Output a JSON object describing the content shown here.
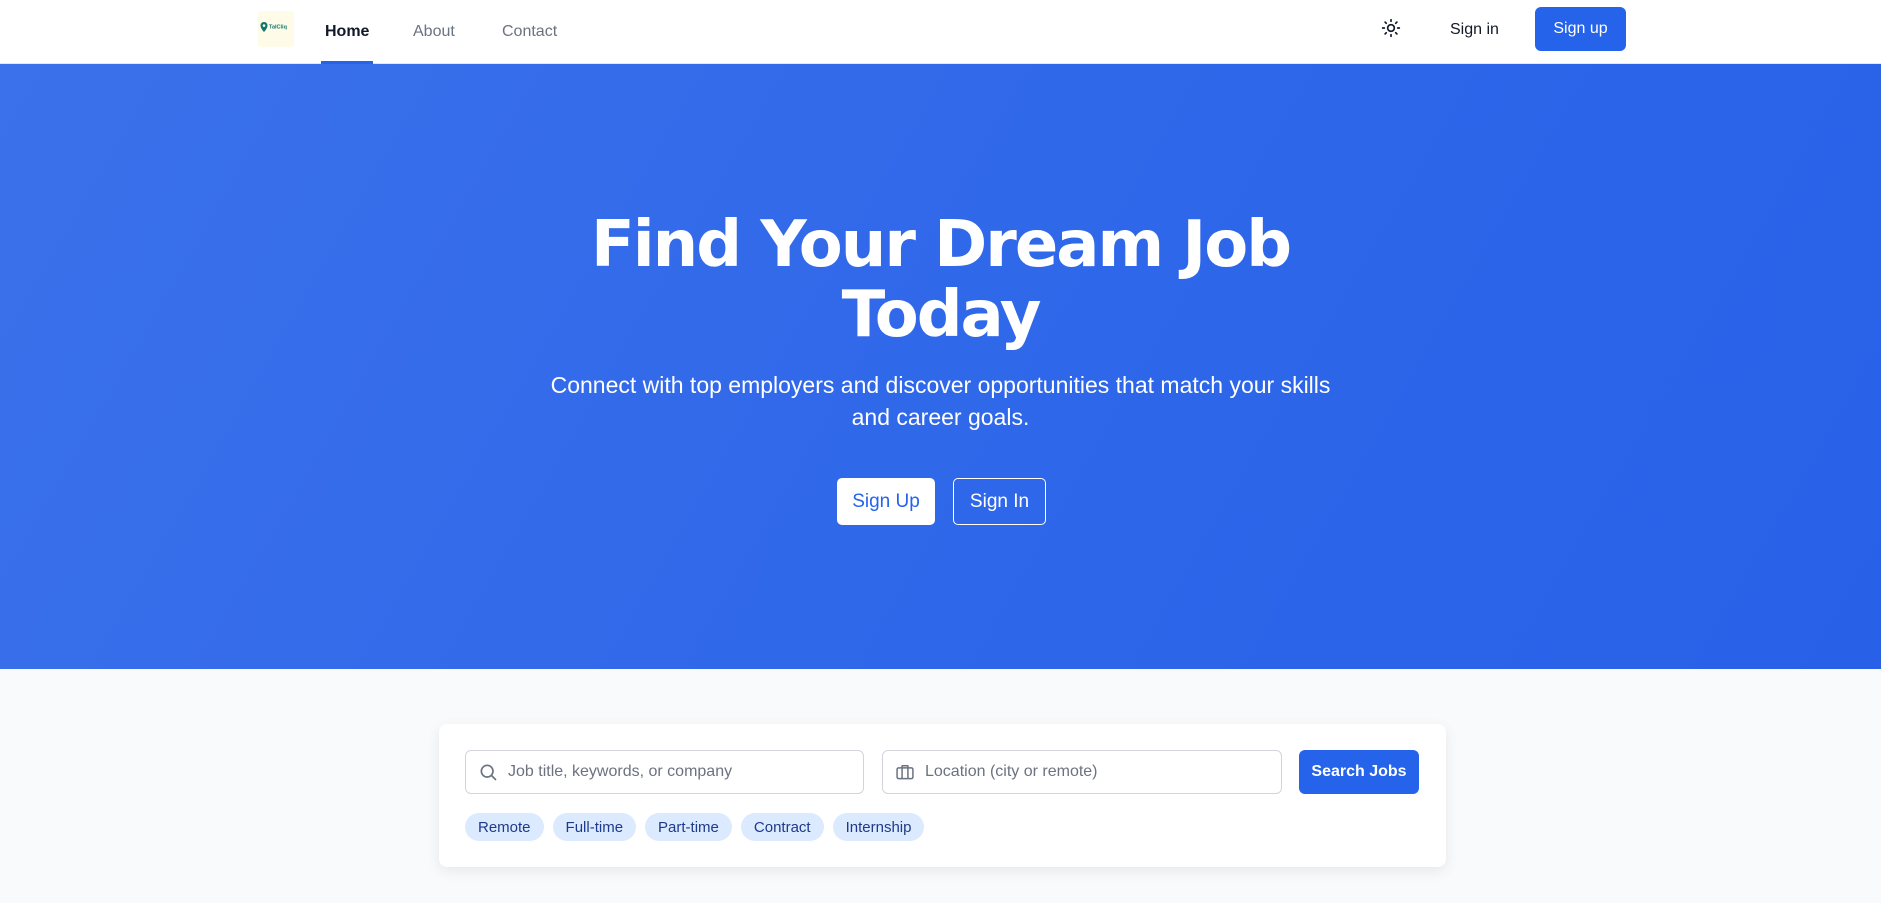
{
  "nav": {
    "logo_text": "TalCliq",
    "links": [
      "Home",
      "About",
      "Contact"
    ],
    "signin": "Sign in",
    "signup": "Sign up"
  },
  "hero": {
    "title_line1": "Find Your Dream Job",
    "title_line2": "Today",
    "subtitle": "Connect with top employers and discover opportunities that match your skills and career goals.",
    "signup": "Sign Up",
    "signin": "Sign In"
  },
  "search": {
    "job_placeholder": "Job title, keywords, or company",
    "location_placeholder": "Location (city or remote)",
    "button": "Search Jobs",
    "chips": [
      "Remote",
      "Full-time",
      "Part-time",
      "Contract",
      "Internship"
    ]
  },
  "colors": {
    "primary": "#2563eb",
    "hero_bg": "#3068ea",
    "chip_bg": "#dbeafe",
    "chip_text": "#1e3a8a",
    "page_bg": "#f8fafc"
  },
  "icons": {
    "logo": "map-pin-icon",
    "theme_toggle": "sun-icon",
    "job_field": "search-icon",
    "location_field": "briefcase-icon"
  }
}
